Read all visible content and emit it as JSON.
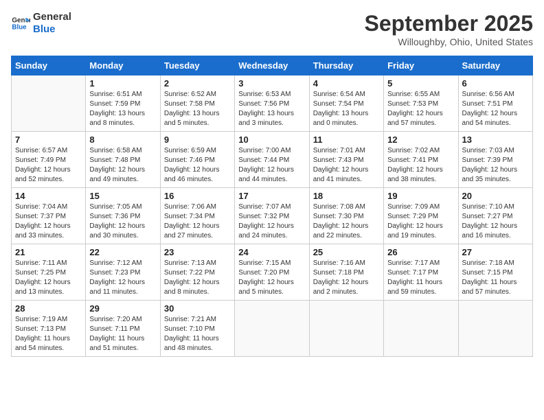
{
  "logo": {
    "line1": "General",
    "line2": "Blue"
  },
  "title": "September 2025",
  "subtitle": "Willoughby, Ohio, United States",
  "days_of_week": [
    "Sunday",
    "Monday",
    "Tuesday",
    "Wednesday",
    "Thursday",
    "Friday",
    "Saturday"
  ],
  "weeks": [
    [
      {
        "day": null
      },
      {
        "day": "1",
        "sunrise": "6:51 AM",
        "sunset": "7:59 PM",
        "daylight": "13 hours and 8 minutes."
      },
      {
        "day": "2",
        "sunrise": "6:52 AM",
        "sunset": "7:58 PM",
        "daylight": "13 hours and 5 minutes."
      },
      {
        "day": "3",
        "sunrise": "6:53 AM",
        "sunset": "7:56 PM",
        "daylight": "13 hours and 3 minutes."
      },
      {
        "day": "4",
        "sunrise": "6:54 AM",
        "sunset": "7:54 PM",
        "daylight": "13 hours and 0 minutes."
      },
      {
        "day": "5",
        "sunrise": "6:55 AM",
        "sunset": "7:53 PM",
        "daylight": "12 hours and 57 minutes."
      },
      {
        "day": "6",
        "sunrise": "6:56 AM",
        "sunset": "7:51 PM",
        "daylight": "12 hours and 54 minutes."
      }
    ],
    [
      {
        "day": "7",
        "sunrise": "6:57 AM",
        "sunset": "7:49 PM",
        "daylight": "12 hours and 52 minutes."
      },
      {
        "day": "8",
        "sunrise": "6:58 AM",
        "sunset": "7:48 PM",
        "daylight": "12 hours and 49 minutes."
      },
      {
        "day": "9",
        "sunrise": "6:59 AM",
        "sunset": "7:46 PM",
        "daylight": "12 hours and 46 minutes."
      },
      {
        "day": "10",
        "sunrise": "7:00 AM",
        "sunset": "7:44 PM",
        "daylight": "12 hours and 44 minutes."
      },
      {
        "day": "11",
        "sunrise": "7:01 AM",
        "sunset": "7:43 PM",
        "daylight": "12 hours and 41 minutes."
      },
      {
        "day": "12",
        "sunrise": "7:02 AM",
        "sunset": "7:41 PM",
        "daylight": "12 hours and 38 minutes."
      },
      {
        "day": "13",
        "sunrise": "7:03 AM",
        "sunset": "7:39 PM",
        "daylight": "12 hours and 35 minutes."
      }
    ],
    [
      {
        "day": "14",
        "sunrise": "7:04 AM",
        "sunset": "7:37 PM",
        "daylight": "12 hours and 33 minutes."
      },
      {
        "day": "15",
        "sunrise": "7:05 AM",
        "sunset": "7:36 PM",
        "daylight": "12 hours and 30 minutes."
      },
      {
        "day": "16",
        "sunrise": "7:06 AM",
        "sunset": "7:34 PM",
        "daylight": "12 hours and 27 minutes."
      },
      {
        "day": "17",
        "sunrise": "7:07 AM",
        "sunset": "7:32 PM",
        "daylight": "12 hours and 24 minutes."
      },
      {
        "day": "18",
        "sunrise": "7:08 AM",
        "sunset": "7:30 PM",
        "daylight": "12 hours and 22 minutes."
      },
      {
        "day": "19",
        "sunrise": "7:09 AM",
        "sunset": "7:29 PM",
        "daylight": "12 hours and 19 minutes."
      },
      {
        "day": "20",
        "sunrise": "7:10 AM",
        "sunset": "7:27 PM",
        "daylight": "12 hours and 16 minutes."
      }
    ],
    [
      {
        "day": "21",
        "sunrise": "7:11 AM",
        "sunset": "7:25 PM",
        "daylight": "12 hours and 13 minutes."
      },
      {
        "day": "22",
        "sunrise": "7:12 AM",
        "sunset": "7:23 PM",
        "daylight": "12 hours and 11 minutes."
      },
      {
        "day": "23",
        "sunrise": "7:13 AM",
        "sunset": "7:22 PM",
        "daylight": "12 hours and 8 minutes."
      },
      {
        "day": "24",
        "sunrise": "7:15 AM",
        "sunset": "7:20 PM",
        "daylight": "12 hours and 5 minutes."
      },
      {
        "day": "25",
        "sunrise": "7:16 AM",
        "sunset": "7:18 PM",
        "daylight": "12 hours and 2 minutes."
      },
      {
        "day": "26",
        "sunrise": "7:17 AM",
        "sunset": "7:17 PM",
        "daylight": "11 hours and 59 minutes."
      },
      {
        "day": "27",
        "sunrise": "7:18 AM",
        "sunset": "7:15 PM",
        "daylight": "11 hours and 57 minutes."
      }
    ],
    [
      {
        "day": "28",
        "sunrise": "7:19 AM",
        "sunset": "7:13 PM",
        "daylight": "11 hours and 54 minutes."
      },
      {
        "day": "29",
        "sunrise": "7:20 AM",
        "sunset": "7:11 PM",
        "daylight": "11 hours and 51 minutes."
      },
      {
        "day": "30",
        "sunrise": "7:21 AM",
        "sunset": "7:10 PM",
        "daylight": "11 hours and 48 minutes."
      },
      {
        "day": null
      },
      {
        "day": null
      },
      {
        "day": null
      },
      {
        "day": null
      }
    ]
  ]
}
